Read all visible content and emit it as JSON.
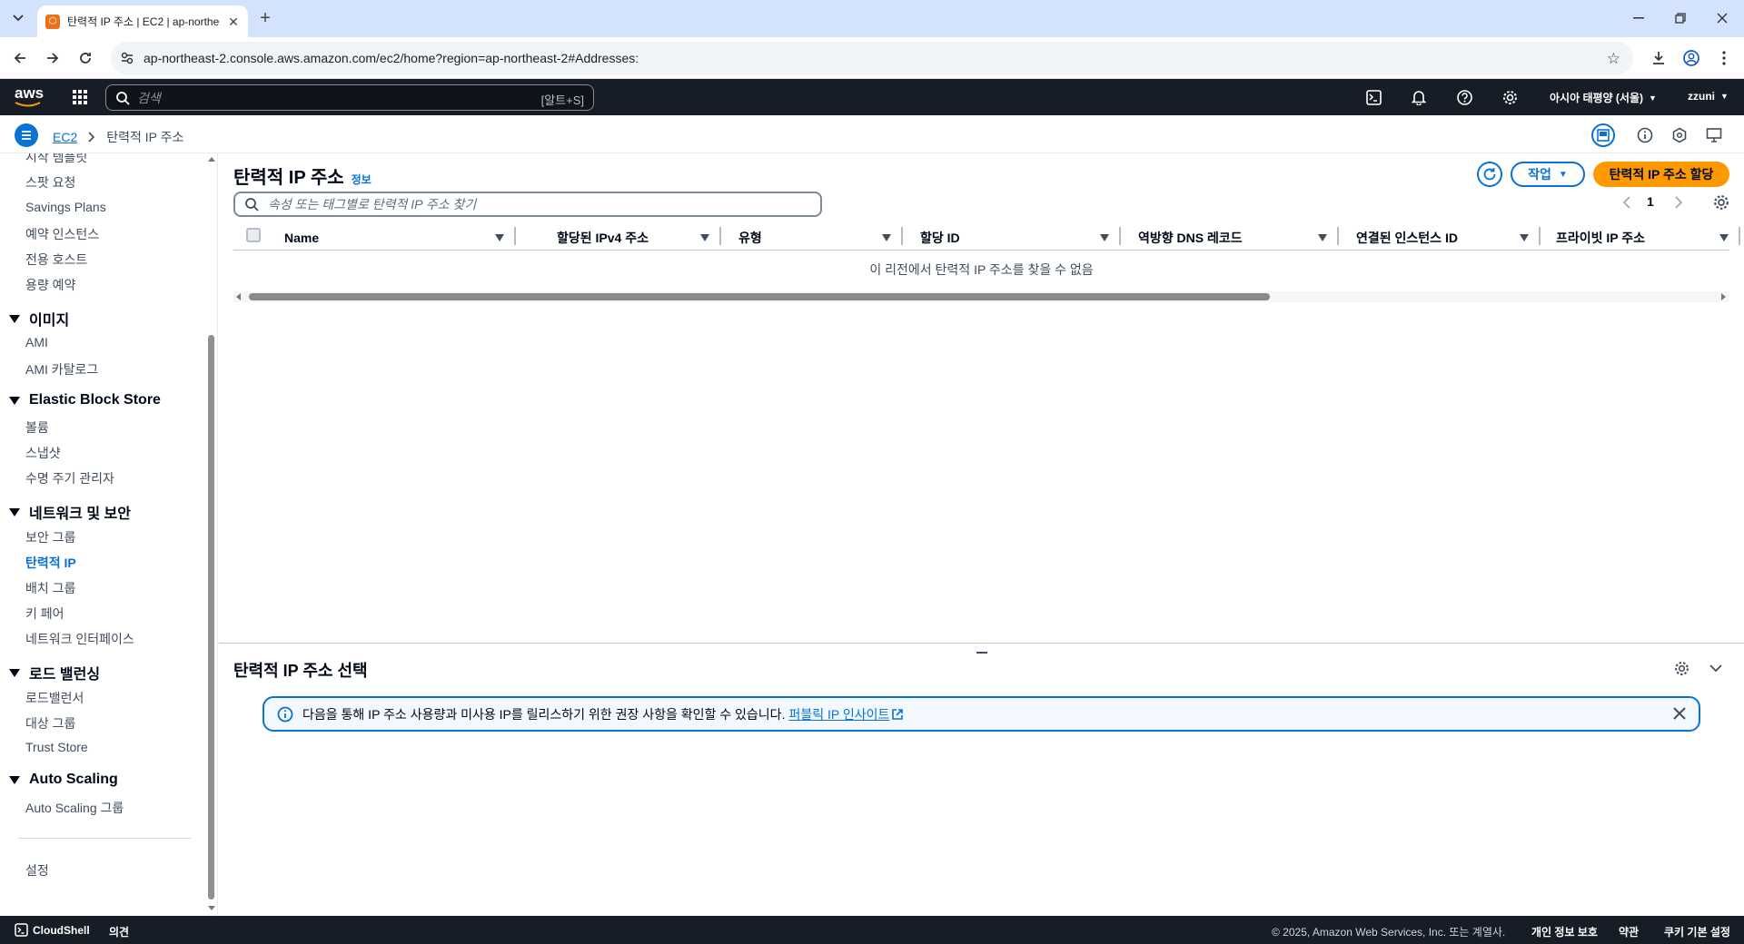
{
  "browser": {
    "tab_title": "탄력적 IP 주소 | EC2 | ap-northe",
    "url": "ap-northeast-2.console.aws.amazon.com/ec2/home?region=ap-northeast-2#Addresses:"
  },
  "aws_nav": {
    "logo": "aws",
    "search_placeholder": "검색",
    "search_shortcut": "[알트+S]",
    "region": "아시아 태평양 (서울)",
    "user": "zzuni"
  },
  "breadcrumb": {
    "service": "EC2",
    "current": "탄력적 IP 주소"
  },
  "sidebar": {
    "top_items": [
      "시작 템플릿",
      "스팟 요청",
      "Savings Plans",
      "예약 인스턴스",
      "전용 호스트",
      "용량 예약"
    ],
    "sections": [
      {
        "title": "이미지",
        "items": [
          "AMI",
          "AMI 카탈로그"
        ]
      },
      {
        "title": "Elastic Block Store",
        "items": [
          "볼륨",
          "스냅샷",
          "수명 주기 관리자"
        ]
      },
      {
        "title": "네트워크 및 보안",
        "items": [
          "보안 그룹",
          "탄력적 IP",
          "배치 그룹",
          "키 페어",
          "네트워크 인터페이스"
        ]
      },
      {
        "title": "로드 밸런싱",
        "items": [
          "로드밸런서",
          "대상 그룹",
          "Trust Store"
        ]
      },
      {
        "title": "Auto Scaling",
        "items": [
          "Auto Scaling 그룹"
        ]
      }
    ],
    "settings": "설정",
    "active_item": "탄력적 IP"
  },
  "main": {
    "title": "탄력적 IP 주소",
    "info_link": "정보",
    "actions_button": "작업",
    "allocate_button": "탄력적 IP 주소 할당",
    "filter_placeholder": "속성 또는 태그별로 탄력적 IP 주소 찾기",
    "page_number": "1",
    "columns": [
      "Name",
      "할당된 IPv4 주소",
      "유형",
      "할당 ID",
      "역방향 DNS 레코드",
      "연결된 인스턴스 ID",
      "프라이빗 IP 주소"
    ],
    "empty_message": "이 리전에서 탄력적 IP 주소를 찾을 수 없음"
  },
  "detail_panel": {
    "title": "탄력적 IP 주소 선택",
    "alert_text": "다음을 통해 IP 주소 사용량과 미사용 IP를 릴리스하기 위한 권장 사항을 확인할 수 있습니다.",
    "alert_link": "퍼블릭 IP 인사이트"
  },
  "footer": {
    "cloudshell": "CloudShell",
    "feedback": "의견",
    "copyright": "© 2025, Amazon Web Services, Inc. 또는 계열사.",
    "privacy": "개인 정보 보호",
    "terms": "약관",
    "cookies": "쿠키 기본 설정"
  },
  "colors": {
    "aws_nav_bg": "#161d26",
    "link_blue": "#0972d3",
    "primary_orange": "#ff9900",
    "alert_border": "#0972d3"
  }
}
